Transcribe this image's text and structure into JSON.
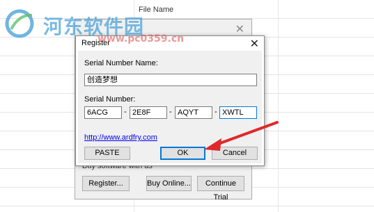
{
  "background": {
    "column_header": "File Name"
  },
  "watermark": {
    "logo_icon": "river-east-logo-icon",
    "text": "河东软件园",
    "url": "www.pc0359.cn"
  },
  "parent_dialog": {
    "close_glyph": "✕",
    "partial_text": "Buy software with as",
    "buttons": {
      "register": "Register...",
      "buy_online": "Buy Online...",
      "continue_trial": "Continue Trial"
    }
  },
  "register_dialog": {
    "title": "Register",
    "close_glyph": "✕",
    "serial_name_label": "Serial Number Name:",
    "serial_name_value": "创造梦想",
    "serial_number_label": "Serial Number:",
    "serial_parts": [
      "6ACG",
      "2E8F",
      "AQYT",
      "XWTL"
    ],
    "separator": "-",
    "link": "http://www.ardfry.com",
    "paste_label": "PASTE",
    "ok_label": "OK",
    "cancel_label": "Cancel"
  },
  "colors": {
    "annotation_arrow": "#e0282a",
    "focus_border": "#0078d7"
  }
}
